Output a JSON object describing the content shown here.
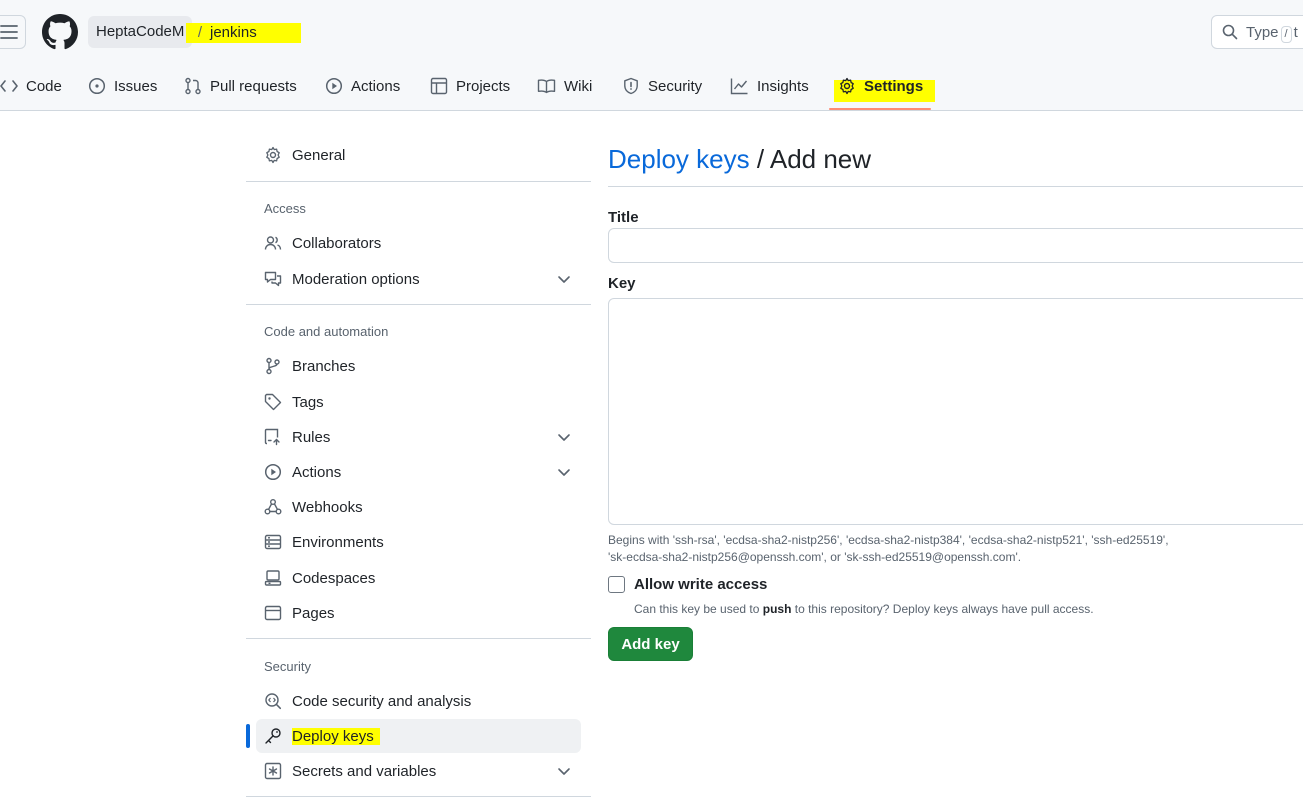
{
  "header": {
    "owner": "HeptaCodeM",
    "separator": "/",
    "repo": "jenkins",
    "search_placeholder": "Type",
    "search_kbd": "/",
    "search_tail": "t"
  },
  "tabs": [
    {
      "label": "Code",
      "icon": "code-icon"
    },
    {
      "label": "Issues",
      "icon": "issue-icon"
    },
    {
      "label": "Pull requests",
      "icon": "pull-request-icon"
    },
    {
      "label": "Actions",
      "icon": "play-icon"
    },
    {
      "label": "Projects",
      "icon": "table-icon"
    },
    {
      "label": "Wiki",
      "icon": "book-icon"
    },
    {
      "label": "Security",
      "icon": "shield-icon"
    },
    {
      "label": "Insights",
      "icon": "graph-icon"
    },
    {
      "label": "Settings",
      "icon": "gear-icon",
      "selected": true
    }
  ],
  "sidebar": {
    "general": "General",
    "access_heading": "Access",
    "access": [
      "Collaborators",
      "Moderation options"
    ],
    "code_heading": "Code and automation",
    "code": [
      "Branches",
      "Tags",
      "Rules",
      "Actions",
      "Webhooks",
      "Environments",
      "Codespaces",
      "Pages"
    ],
    "security_heading": "Security",
    "security": [
      "Code security and analysis",
      "Deploy keys",
      "Secrets and variables"
    ]
  },
  "main": {
    "breadcrumb_link": "Deploy keys",
    "breadcrumb_rest": " / Add new",
    "title_label": "Title",
    "title_value": "",
    "key_label": "Key",
    "key_value": "",
    "key_note_1": "Begins with 'ssh-rsa', 'ecdsa-sha2-nistp256', 'ecdsa-sha2-nistp384', 'ecdsa-sha2-nistp521', 'ssh-ed25519',",
    "key_note_2": "'sk-ecdsa-sha2-nistp256@openssh.com', or 'sk-ssh-ed25519@openssh.com'.",
    "write_access_label": "Allow write access",
    "write_access_checked": false,
    "write_note_pre": "Can this key be used to ",
    "write_note_bold": "push",
    "write_note_post": " to this repository? Deploy keys always have pull access.",
    "add_button": "Add key"
  },
  "colors": {
    "highlight": "#ffff00",
    "link": "#0969da",
    "primary_button": "#1f883d",
    "tab_underline": "#fd8c73"
  }
}
